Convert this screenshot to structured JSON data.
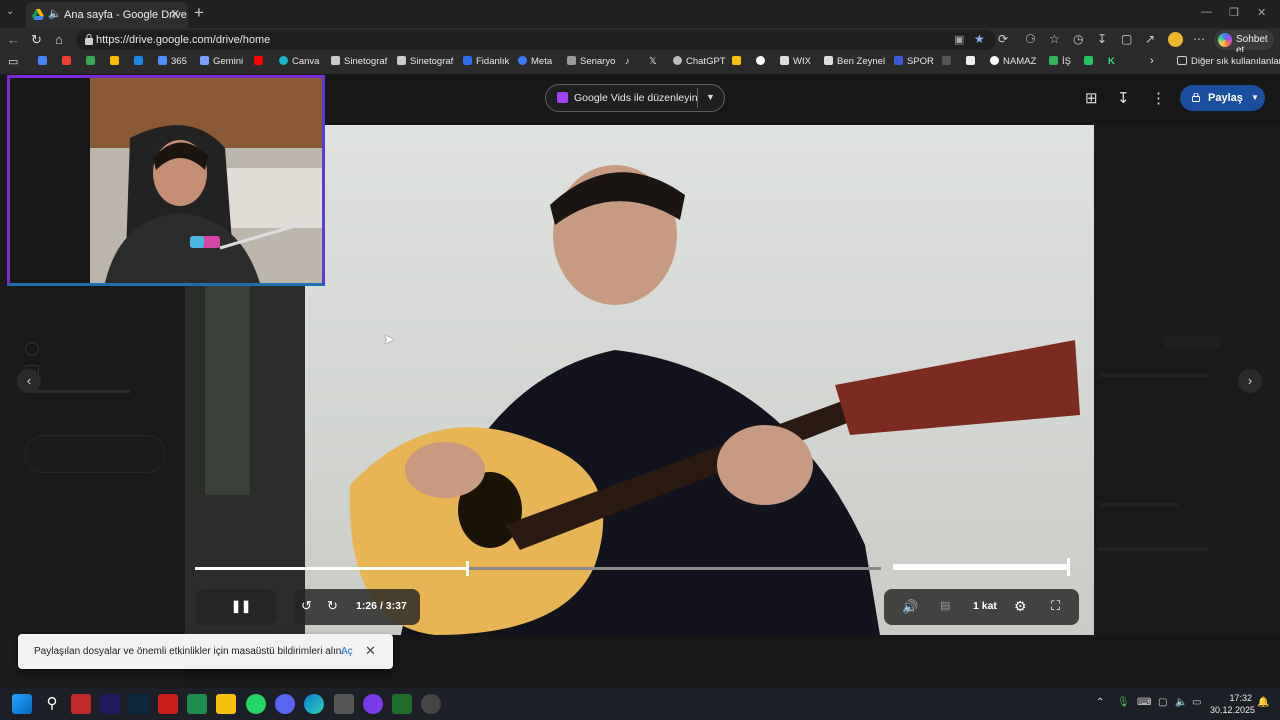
{
  "browser": {
    "tab_title": "Ana sayfa - Google Drive",
    "url": "https://drive.google.com/drive/home",
    "copilot_label": "Sohbet et",
    "bookmarks": [
      {
        "label": "365",
        "color": "#4f8cff"
      },
      {
        "label": "Gemini",
        "color": "#7b9cff"
      },
      {
        "label": "Canva",
        "color": "#19b6c9"
      },
      {
        "label": "Sinetograf",
        "color": "#dddddd"
      },
      {
        "label": "Sinetograf",
        "color": "#dddddd"
      },
      {
        "label": "Fidanlık",
        "color": "#2d6ef5"
      },
      {
        "label": "Meta",
        "color": "#3b7cff"
      },
      {
        "label": "Senaryo",
        "color": "#dddddd"
      },
      {
        "label": "ChatGPT",
        "color": "#dddddd"
      },
      {
        "label": "WIX",
        "color": "#dddddd"
      },
      {
        "label": "Ben Zeynel",
        "color": "#dddddd"
      },
      {
        "label": "SPOR",
        "color": "#3b5bdb"
      },
      {
        "label": "NAMAZ",
        "color": "#dddddd"
      },
      {
        "label": "İŞ",
        "color": "#2fb35b"
      },
      {
        "label": "Diğer sık kullanılanlar",
        "color": "#dddddd"
      }
    ]
  },
  "drive_viewer": {
    "edit_button_label": "Google Vids ile düzenleyin",
    "share_label": "Paylaş",
    "player": {
      "current_time": "1:26",
      "duration": "/ 3:37",
      "progress_fraction": 0.396,
      "volume_fraction": 1.0,
      "speed_label": "1 kat"
    }
  },
  "toast": {
    "message": "Paylaşılan dosyalar ve önemli etkinlikler için masaüstü bildirimleri alın.",
    "action_label": "Aç"
  },
  "taskbar": {
    "time": "17:32",
    "date": "30.12.2025"
  },
  "colors": {
    "accent_purple": "#a142f4",
    "share_blue": "#1a4fa0",
    "link_blue": "#1a73e8",
    "webcam_border": "#7a2bd1"
  }
}
